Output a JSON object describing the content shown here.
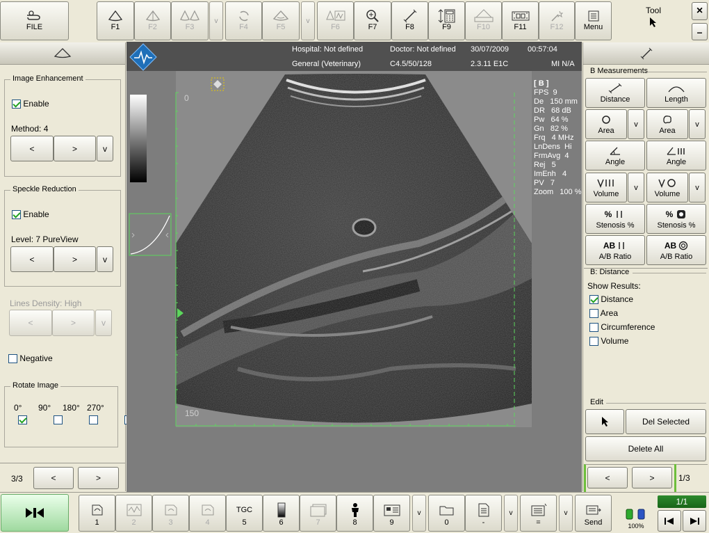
{
  "toolbar": {
    "file": "FILE",
    "f1": "F1",
    "f2": "F2",
    "f3": "F3",
    "f4": "F4",
    "f5": "F5",
    "f6": "F6",
    "f7": "F7",
    "f8": "F8",
    "f9": "F9",
    "f10": "F10",
    "f11": "F11",
    "f12": "F12",
    "menu": "Menu",
    "tool": "Tool",
    "v": "v",
    "close": "×",
    "minimize": "–"
  },
  "header": {
    "hospital": "Hospital: Not defined",
    "doctor": "Doctor: Not defined",
    "date": "30/07/2009",
    "time": "00:57:04",
    "preset": "General (Veterinary)",
    "probe": "C4.5/50/128",
    "version": "2.3.11 E1C",
    "mi": "MI N/A"
  },
  "left": {
    "enh_title": "Image Enhancement",
    "enable": "Enable",
    "method": "Method: 4",
    "speckle_title": "Speckle Reduction",
    "level": "Level: 7 PureView",
    "lines_density": "Lines Density: High",
    "negative": "Negative",
    "rotate_title": "Rotate Image",
    "r0": "0°",
    "r90": "90°",
    "r180": "180°",
    "r270": "270°",
    "prev": "<",
    "next": ">",
    "v": "v",
    "page": "3/3"
  },
  "image": {
    "depth_top": "0",
    "depth_bottom": "150"
  },
  "params": {
    "mode": "[ B ]",
    "lines": [
      "FPS  9",
      "De   150 mm",
      "DR   68 dB",
      "Pw   64 %",
      "Gn   82 %",
      "Frq   4 MHz",
      "LnDens  Hi",
      "FrmAvg  4",
      "Rej   5",
      "ImEnh   4",
      "PV   7",
      "Zoom   100 %"
    ]
  },
  "right": {
    "measure_title": "B Measurements",
    "distance": "Distance",
    "length": "Length",
    "area": "Area",
    "angle": "Angle",
    "volume": "Volume",
    "stenosis": "Stenosis %",
    "ab_ratio": "A/B Ratio",
    "bdist_title": "B: Distance",
    "show_results": "Show Results:",
    "res_distance": "Distance",
    "res_area": "Area",
    "res_circumference": "Circumference",
    "res_volume": "Volume",
    "edit_title": "Edit",
    "del_selected": "Del Selected",
    "delete_all": "Delete All",
    "prev": "<",
    "next": ">",
    "page": "1/3",
    "v": "v"
  },
  "bottom": {
    "b1": "1",
    "b2": "2",
    "b3": "3",
    "b4": "4",
    "tgc": "TGC",
    "b5": "5",
    "b6": "6",
    "b7": "7",
    "b8": "8",
    "b9": "9",
    "b0": "0",
    "dash": "-",
    "eq": "=",
    "send": "Send",
    "v": "v",
    "battery": "100%",
    "counter": "1/1"
  },
  "colors": {
    "accent_green": "#6dbe3c",
    "panel_bg": "#ece9d8",
    "image_bg": "#7f7f7f"
  }
}
